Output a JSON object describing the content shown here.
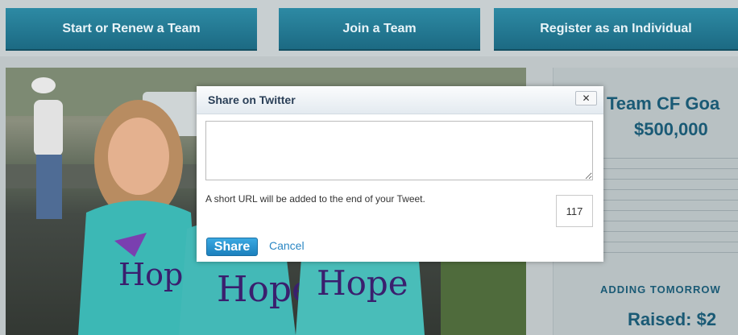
{
  "nav": {
    "start_label": "Start or Renew a Team",
    "join_label": "Join a Team",
    "register_label": "Register as an Individual"
  },
  "sidebar": {
    "goal_title": "Team CF Goa",
    "goal_amount": "$500,000",
    "adding_text": "ADDING TOMORROW",
    "raised_text": "Raised: $2"
  },
  "photo": {
    "shirt_text": "Hope"
  },
  "modal": {
    "title": "Share on Twitter",
    "close_label": "✕",
    "tweet_value": "",
    "hint": "A short URL will be added to the end of your Tweet.",
    "counter": "117",
    "share_label": "Share",
    "cancel_label": "Cancel"
  },
  "colors": {
    "nav_blue": "#1f6f88",
    "heading_blue": "#1a5a75",
    "share_blue": "#2a94d0",
    "link_blue": "#2b87c4"
  }
}
